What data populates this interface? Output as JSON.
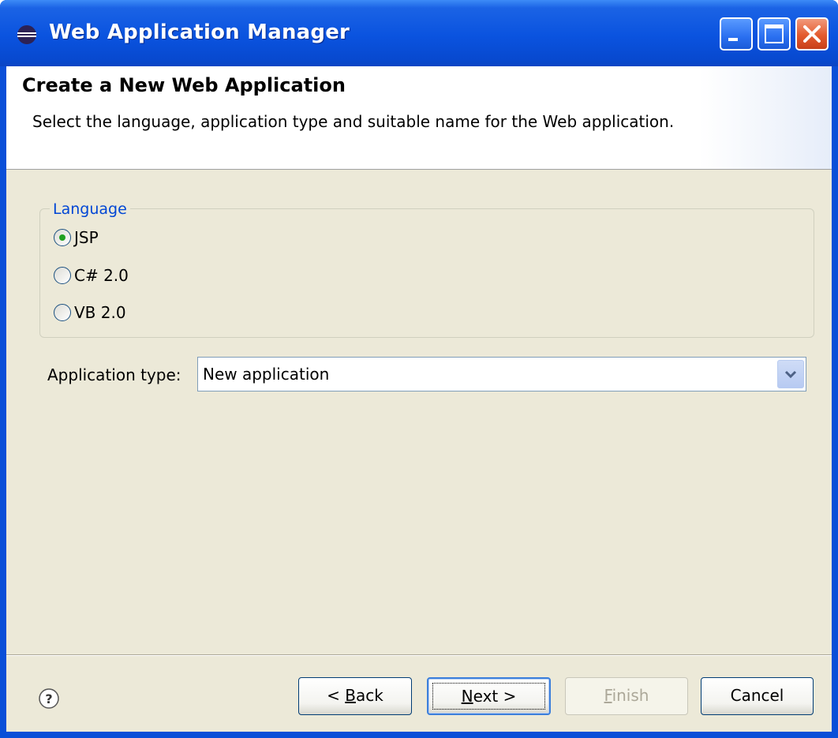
{
  "window": {
    "title": "Web Application Manager"
  },
  "banner": {
    "title": "Create a New Web Application",
    "description": "Select the language, application type and suitable name for the Web application."
  },
  "language_group": {
    "label": "Language",
    "options": [
      {
        "label": "JSP",
        "selected": true
      },
      {
        "label": "C# 2.0",
        "selected": false
      },
      {
        "label": "VB 2.0",
        "selected": false
      }
    ]
  },
  "application_type": {
    "label": "Application type:",
    "value": "New application"
  },
  "buttons": {
    "back": {
      "prefix": "< ",
      "mnemonic": "B",
      "rest": "ack"
    },
    "next": {
      "mnemonic": "N",
      "rest": "ext >"
    },
    "finish": {
      "mnemonic": "F",
      "rest": "inish",
      "enabled": false
    },
    "cancel": {
      "label": "Cancel"
    }
  },
  "icons": {
    "app_icon": "eclipse-icon",
    "help_icon": "help-icon",
    "minimize": "minimize-icon",
    "maximize": "maximize-icon",
    "close": "close-icon"
  },
  "colors": {
    "titlebar": "#0a53df",
    "dialog_bg": "#ece9d8",
    "group_label": "#0046d5",
    "radio_selected": "#21a121"
  }
}
